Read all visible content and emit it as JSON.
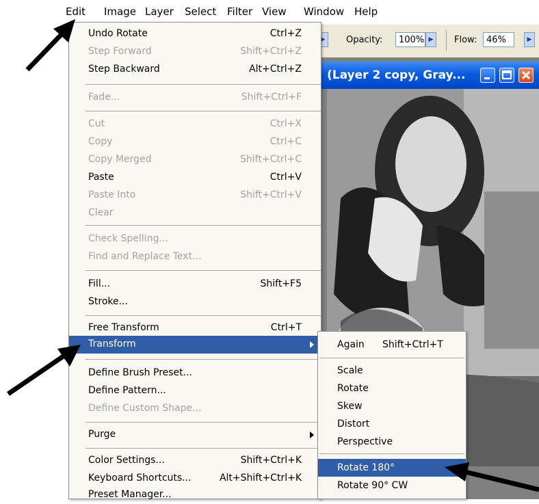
{
  "menubar": {
    "items": [
      "Edit",
      "Image",
      "Layer",
      "Select",
      "Filter",
      "View",
      "Window",
      "Help"
    ]
  },
  "options_bar": {
    "opacity_label": "Opacity:",
    "opacity_value": "100%",
    "flow_label": "Flow:",
    "flow_value": "46%"
  },
  "document": {
    "title": "(Layer 2 copy, Gray..."
  },
  "edit_menu": {
    "items": [
      {
        "label": "Undo Rotate",
        "shortcut": "Ctrl+Z",
        "enabled": true
      },
      {
        "label": "Step Forward",
        "shortcut": "Shift+Ctrl+Z",
        "enabled": false
      },
      {
        "label": "Step Backward",
        "shortcut": "Alt+Ctrl+Z",
        "enabled": true
      },
      {
        "label": "Fade...",
        "shortcut": "Shift+Ctrl+F",
        "enabled": false
      },
      {
        "label": "Cut",
        "shortcut": "Ctrl+X",
        "enabled": false
      },
      {
        "label": "Copy",
        "shortcut": "Ctrl+C",
        "enabled": false
      },
      {
        "label": "Copy Merged",
        "shortcut": "Shift+Ctrl+C",
        "enabled": false
      },
      {
        "label": "Paste",
        "shortcut": "Ctrl+V",
        "enabled": true
      },
      {
        "label": "Paste Into",
        "shortcut": "Shift+Ctrl+V",
        "enabled": false
      },
      {
        "label": "Clear",
        "shortcut": "",
        "enabled": false
      },
      {
        "label": "Check Spelling...",
        "shortcut": "",
        "enabled": false
      },
      {
        "label": "Find and Replace Text...",
        "shortcut": "",
        "enabled": false
      },
      {
        "label": "Fill...",
        "shortcut": "Shift+F5",
        "enabled": true
      },
      {
        "label": "Stroke...",
        "shortcut": "",
        "enabled": true
      },
      {
        "label": "Free Transform",
        "shortcut": "Ctrl+T",
        "enabled": true
      },
      {
        "label": "Transform",
        "shortcut": "",
        "enabled": true,
        "highlighted": true,
        "submenu": true
      },
      {
        "label": "Define Brush Preset...",
        "shortcut": "",
        "enabled": true
      },
      {
        "label": "Define Pattern...",
        "shortcut": "",
        "enabled": true
      },
      {
        "label": "Define Custom Shape...",
        "shortcut": "",
        "enabled": false
      },
      {
        "label": "Purge",
        "shortcut": "",
        "enabled": true,
        "submenu": true
      },
      {
        "label": "Color Settings...",
        "shortcut": "Shift+Ctrl+K",
        "enabled": true
      },
      {
        "label": "Keyboard Shortcuts...",
        "shortcut": "Alt+Shift+Ctrl+K",
        "enabled": true
      },
      {
        "label": "Preset Manager...",
        "shortcut": "",
        "enabled": true
      }
    ]
  },
  "transform_submenu": {
    "items": [
      {
        "label": "Again",
        "shortcut": "Shift+Ctrl+T"
      },
      {
        "label": "Scale",
        "shortcut": ""
      },
      {
        "label": "Rotate",
        "shortcut": ""
      },
      {
        "label": "Skew",
        "shortcut": ""
      },
      {
        "label": "Distort",
        "shortcut": ""
      },
      {
        "label": "Perspective",
        "shortcut": ""
      },
      {
        "label": "Rotate 180°",
        "shortcut": "",
        "highlighted": true
      },
      {
        "label": "Rotate 90° CW",
        "shortcut": ""
      }
    ]
  },
  "colors": {
    "highlight": "#2f5da8",
    "menu_bg": "#f9f8f3",
    "titlebar": "#0a5ce0",
    "disabled_text": "#a2a2a2"
  }
}
